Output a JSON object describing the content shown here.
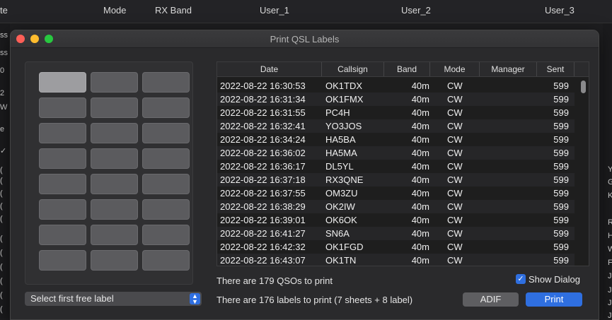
{
  "background": {
    "columns": [
      "te",
      "Mode",
      "RX Band",
      "User_1",
      "User_2",
      "User_3"
    ],
    "left_fragments": [
      "ss",
      "ss",
      "0",
      "2",
      "W",
      "e",
      "✓",
      "(",
      "(",
      "(",
      "(",
      "(",
      "(",
      "(",
      "(",
      "(",
      "(",
      "("
    ],
    "right_fragments": [
      "Y",
      "G",
      "K",
      "R",
      "H",
      "W",
      "F",
      "J",
      "J",
      "J",
      "J"
    ]
  },
  "dialog": {
    "title": "Print QSL Labels",
    "table": {
      "columns": [
        "Date",
        "Callsign",
        "Band",
        "Mode",
        "Manager",
        "Sent"
      ],
      "rows": [
        [
          "2022-08-22 16:30:53",
          "OK1TDX",
          "40m",
          "CW",
          "",
          "599"
        ],
        [
          "2022-08-22 16:31:34",
          "OK1FMX",
          "40m",
          "CW",
          "",
          "599"
        ],
        [
          "2022-08-22 16:31:55",
          "PC4H",
          "40m",
          "CW",
          "",
          "599"
        ],
        [
          "2022-08-22 16:32:41",
          "YO3JOS",
          "40m",
          "CW",
          "",
          "599"
        ],
        [
          "2022-08-22 16:34:24",
          "HA5BA",
          "40m",
          "CW",
          "",
          "599"
        ],
        [
          "2022-08-22 16:36:02",
          "HA5MA",
          "40m",
          "CW",
          "",
          "599"
        ],
        [
          "2022-08-22 16:36:17",
          "DL5YL",
          "40m",
          "CW",
          "",
          "599"
        ],
        [
          "2022-08-22 16:37:18",
          "RX3QNE",
          "40m",
          "CW",
          "",
          "599"
        ],
        [
          "2022-08-22 16:37:55",
          "OM3ZU",
          "40m",
          "CW",
          "",
          "599"
        ],
        [
          "2022-08-22 16:38:29",
          "OK2IW",
          "40m",
          "CW",
          "",
          "599"
        ],
        [
          "2022-08-22 16:39:01",
          "OK6OK",
          "40m",
          "CW",
          "",
          "599"
        ],
        [
          "2022-08-22 16:41:27",
          "SN6A",
          "40m",
          "CW",
          "",
          "599"
        ],
        [
          "2022-08-22 16:42:32",
          "OK1FGD",
          "40m",
          "CW",
          "",
          "599"
        ],
        [
          "2022-08-22 16:43:07",
          "OK1TN",
          "40m",
          "CW",
          "",
          "599"
        ]
      ]
    },
    "labels": {
      "rows": 8,
      "cols": 3,
      "selected_index": 0
    },
    "select_label": "Select first free label",
    "qso_count_text": "There are 179 QSOs to print",
    "label_count_text": "There are 176 labels to print (7 sheets + 8 label)",
    "show_dialog_label": "Show Dialog",
    "show_dialog_checked": true,
    "adif_label": "ADIF",
    "print_label": "Print"
  }
}
